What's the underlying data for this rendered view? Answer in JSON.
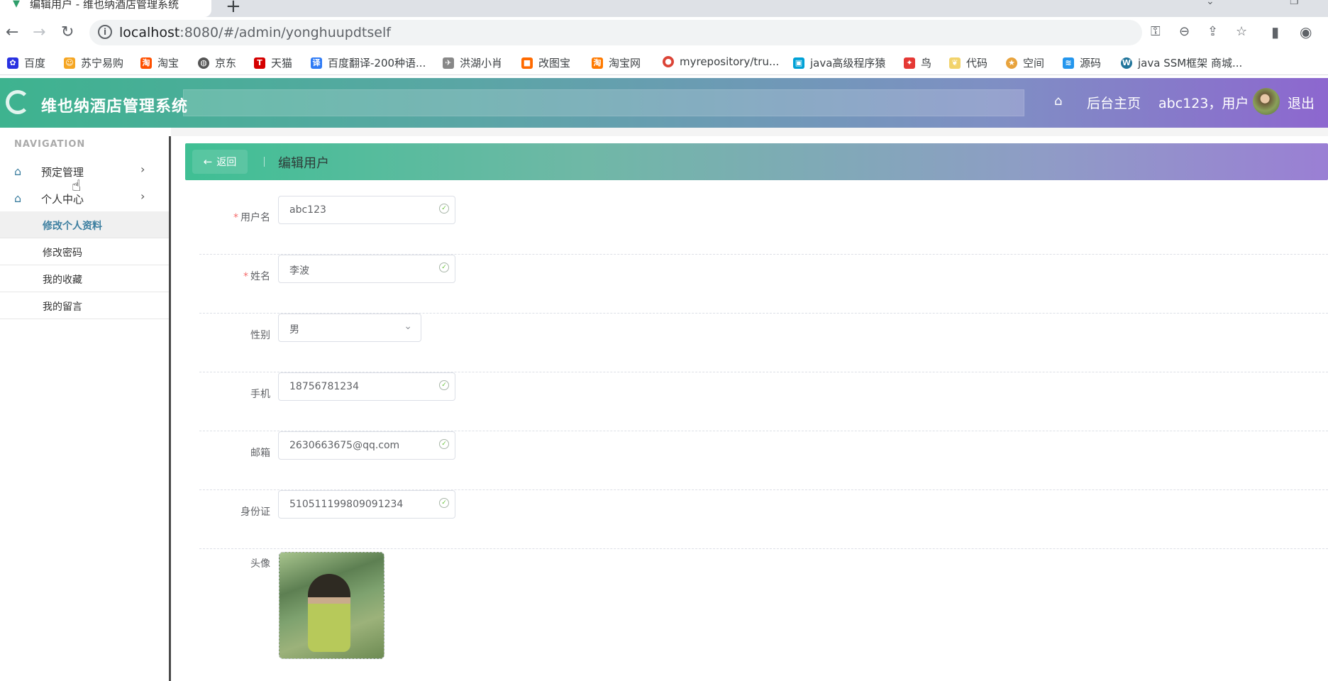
{
  "browser": {
    "tab_title": "编辑用户 - 维也纳酒店管理系统",
    "url_host": "localhost",
    "url_rest": ":8080/#/admin/yonghuupdtself",
    "bookmarks": [
      {
        "label": "百度",
        "icon": "baidu-paw-icon",
        "color": "#2932e1"
      },
      {
        "label": "苏宁易购",
        "icon": "suning-icon",
        "color": "#f5a623"
      },
      {
        "label": "淘宝",
        "icon": "taobao-icon",
        "color": "#ff5000"
      },
      {
        "label": "京东",
        "icon": "globe-icon",
        "color": "#555555"
      },
      {
        "label": "天猫",
        "icon": "tmall-icon",
        "color": "#d50000"
      },
      {
        "label": "百度翻译-200种语...",
        "icon": "translate-icon",
        "color": "#2f7bf5"
      },
      {
        "label": "洪湖小肖",
        "icon": "bird-icon",
        "color": "#888888"
      },
      {
        "label": "改图宝",
        "icon": "gaitubao-icon",
        "color": "#ff6a00"
      },
      {
        "label": "淘宝网",
        "icon": "taobao-icon",
        "color": "#ff7a00"
      },
      {
        "label": "myrepository/tru...",
        "icon": "chrome-icon",
        "color": "#db4437"
      },
      {
        "label": "java高级程序猿",
        "icon": "bilibili-icon",
        "color": "#00a1d6"
      },
      {
        "label": "鸟",
        "icon": "bird-red-icon",
        "color": "#e53935"
      },
      {
        "label": "代码",
        "icon": "leaf-icon",
        "color": "#f2d36b"
      },
      {
        "label": "空间",
        "icon": "qzone-icon",
        "color": "#e8a33d"
      },
      {
        "label": "源码",
        "icon": "docker-icon",
        "color": "#2496ed"
      },
      {
        "label": "java SSM框架 商城...",
        "icon": "wordpress-icon",
        "color": "#21759b"
      }
    ]
  },
  "header": {
    "app_title": "维也纳酒店管理系统",
    "home_link": "后台主页",
    "user_text": "abc123，用户",
    "logout": "退出"
  },
  "sidebar": {
    "caption": "NAVIGATION",
    "menus": [
      {
        "label": "预定管理"
      },
      {
        "label": "个人中心"
      }
    ],
    "sub_items": [
      {
        "label": "修改个人资料",
        "active": true
      },
      {
        "label": "修改密码"
      },
      {
        "label": "我的收藏"
      },
      {
        "label": "我的留言"
      }
    ]
  },
  "page": {
    "back_label": "返回",
    "title": "编辑用户"
  },
  "form": {
    "username": {
      "label": "用户名",
      "value": "abc123",
      "required": true
    },
    "name": {
      "label": "姓名",
      "value": "李波",
      "required": true
    },
    "gender": {
      "label": "性别",
      "value": "男"
    },
    "phone": {
      "label": "手机",
      "value": "18756781234"
    },
    "email": {
      "label": "邮箱",
      "value": "2630663675@qq.com"
    },
    "idcard": {
      "label": "身份证",
      "value": "510511199809091234"
    },
    "avatar": {
      "label": "头像"
    }
  }
}
